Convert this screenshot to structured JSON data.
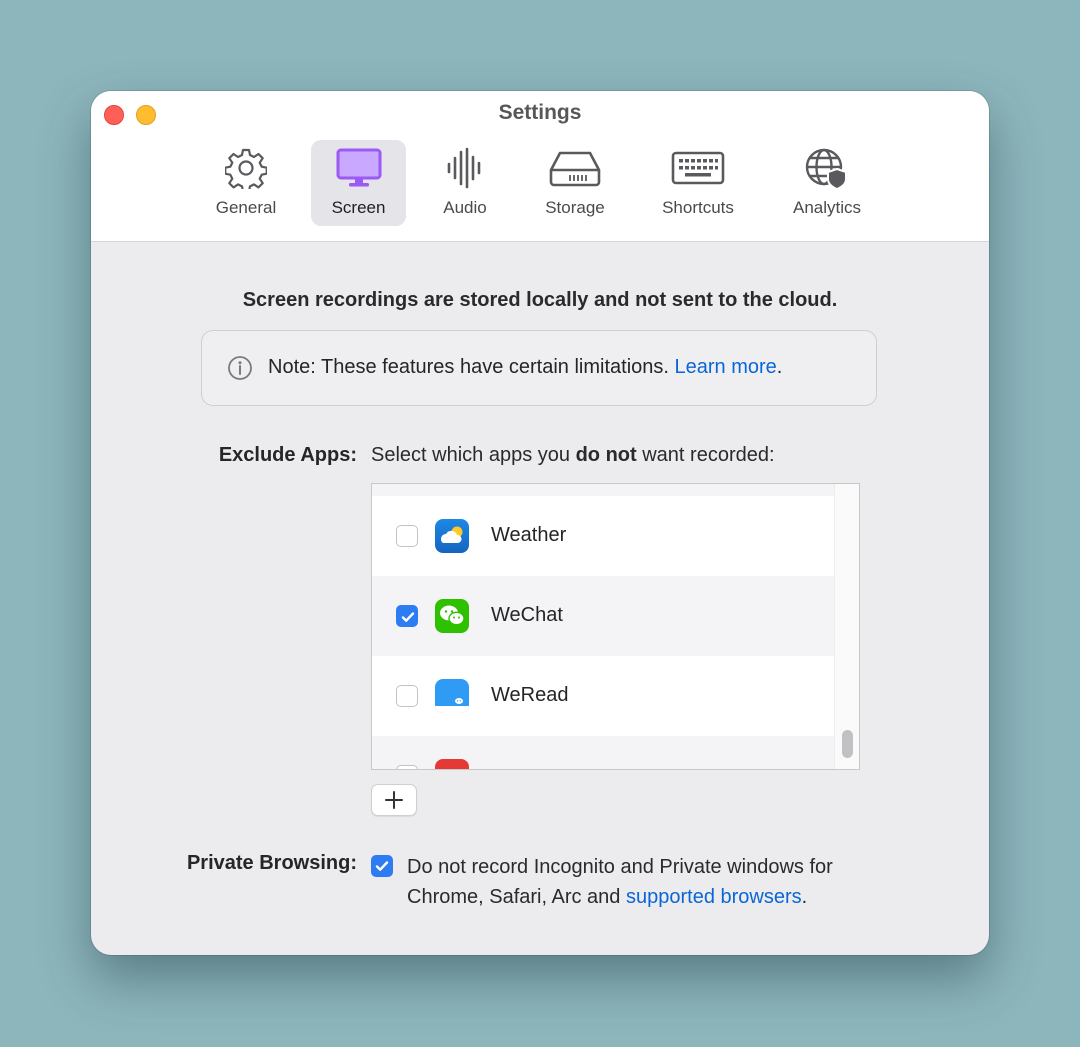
{
  "window": {
    "title": "Settings"
  },
  "tabs": [
    {
      "label": "General",
      "icon": "gear-icon",
      "selected": false
    },
    {
      "label": "Screen",
      "icon": "monitor-icon",
      "selected": true
    },
    {
      "label": "Audio",
      "icon": "waveform-icon",
      "selected": false
    },
    {
      "label": "Storage",
      "icon": "drive-icon",
      "selected": false
    },
    {
      "label": "Shortcuts",
      "icon": "keyboard-icon",
      "selected": false
    },
    {
      "label": "Analytics",
      "icon": "globe-shield-icon",
      "selected": false
    }
  ],
  "screen": {
    "headline": "Screen recordings are stored locally and not sent to the cloud.",
    "note": {
      "text": "Note: These features have certain limitations.",
      "link": "Learn more",
      "suffix": ".",
      "icon": "info-icon"
    },
    "exclude_apps": {
      "label": "Exclude Apps:",
      "prompt_before": "Select which apps you",
      "prompt_bold": "do not",
      "prompt_after": "want recorded:",
      "apps": [
        {
          "name": "Weather",
          "checked": false,
          "icon": "weather-app-icon"
        },
        {
          "name": "WeChat",
          "checked": true,
          "icon": "wechat-app-icon"
        },
        {
          "name": "WeRead",
          "checked": false,
          "icon": "weread-app-icon"
        }
      ],
      "add_button": "+"
    },
    "private_browsing": {
      "label": "Private Browsing:",
      "checked": true,
      "text_line1": "Do not record Incognito and Private windows for",
      "text_line2": "Chrome, Safari, Arc and",
      "link": "supported browsers",
      "suffix": "."
    }
  },
  "colors": {
    "accent": "#2d7cf2",
    "link": "#0a66d6",
    "selected_tab_icon": "#9b59f5",
    "background": "#8db5bc"
  }
}
